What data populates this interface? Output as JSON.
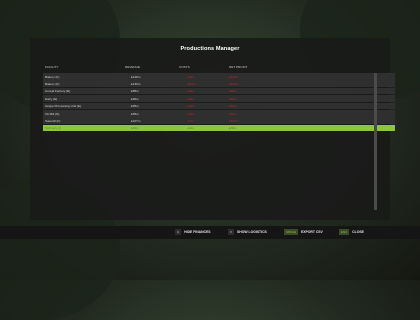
{
  "panel": {
    "title": "Productions Manager",
    "columns": {
      "facility": "FACILITY",
      "revenue": "REVENUE",
      "costs": "COSTS",
      "net_profit": "NET PROFIT"
    },
    "rows": [
      {
        "facility": "Bakery (F)",
        "revenue": "£128m",
        "costs": "-£8m",
        "net": "£120m"
      },
      {
        "facility": "Bakery (F)",
        "revenue": "£130m",
        "costs": "-£10m",
        "net": "£120m"
      },
      {
        "facility": "Cereal Factory (E)",
        "revenue": "£85m",
        "costs": "-£5m",
        "net": "£80m"
      },
      {
        "facility": "Dairy (E)",
        "revenue": "£90m",
        "costs": "-£6m",
        "net": "£84m"
      },
      {
        "facility": "Grape Processing Unit (E)",
        "revenue": "£65m",
        "costs": "-£4m",
        "net": "£61m"
      },
      {
        "facility": "Oil Mill (D)",
        "revenue": "£55m",
        "costs": "-£3m",
        "net": "£52m"
      },
      {
        "facility": "Sawmill (F)",
        "revenue": "£107m",
        "costs": "-£7m",
        "net": "£100m"
      },
      {
        "facility": "Spinnery (I)",
        "revenue": "£40m",
        "costs": "-£2m",
        "net": "£38m"
      }
    ],
    "selected_index": 7
  },
  "footer": {
    "hide_finances": {
      "key": "C",
      "label": "HIDE FINANCES"
    },
    "show_logistics": {
      "key": "V",
      "label": "SHOW LOGISTICS"
    },
    "export_csv": {
      "key": "SPACE",
      "label": "EXPORT CSV"
    },
    "close": {
      "key": "ESC",
      "label": "CLOSE"
    }
  }
}
